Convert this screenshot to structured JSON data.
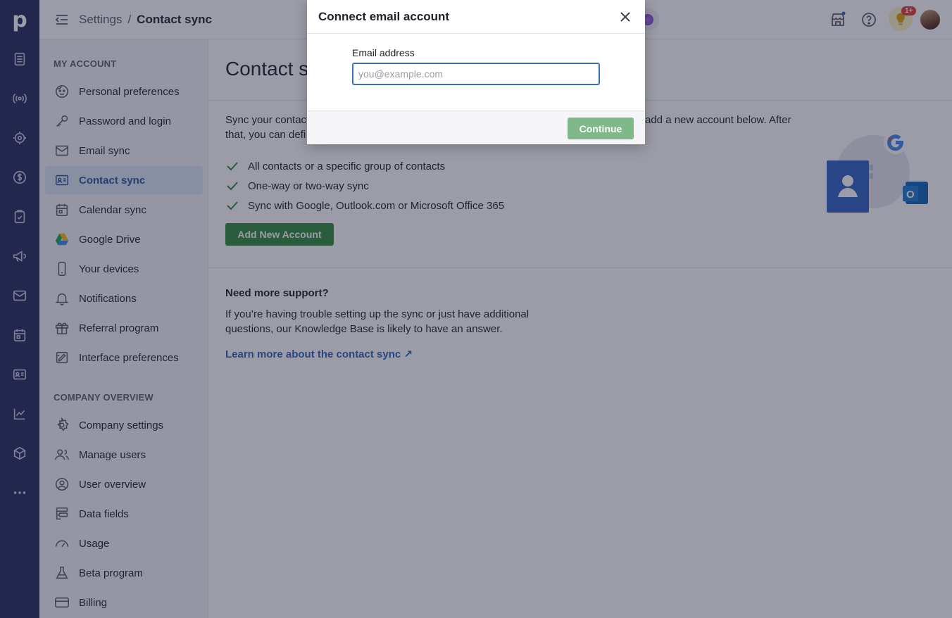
{
  "app": {
    "logo": "p"
  },
  "breadcrumb": {
    "parent": "Settings",
    "separator": "/",
    "current": "Contact sync"
  },
  "topbar": {
    "notification_badge": "1+"
  },
  "sidebar": {
    "section_account": "MY ACCOUNT",
    "account_items": [
      {
        "label": "Personal preferences",
        "icon": "face-icon"
      },
      {
        "label": "Password and login",
        "icon": "key-icon"
      },
      {
        "label": "Email sync",
        "icon": "mail-icon"
      },
      {
        "label": "Contact sync",
        "icon": "contact-card-icon",
        "active": true
      },
      {
        "label": "Calendar sync",
        "icon": "calendar-icon"
      },
      {
        "label": "Google Drive",
        "icon": "google-drive-icon"
      },
      {
        "label": "Your devices",
        "icon": "phone-icon"
      },
      {
        "label": "Notifications",
        "icon": "bell-icon"
      },
      {
        "label": "Referral program",
        "icon": "gift-icon"
      },
      {
        "label": "Interface preferences",
        "icon": "interface-icon"
      }
    ],
    "section_company": "COMPANY OVERVIEW",
    "company_items": [
      {
        "label": "Company settings",
        "icon": "gear-icon"
      },
      {
        "label": "Manage users",
        "icon": "users-icon"
      },
      {
        "label": "User overview",
        "icon": "user-circle-icon"
      },
      {
        "label": "Data fields",
        "icon": "data-fields-icon"
      },
      {
        "label": "Usage",
        "icon": "gauge-icon"
      },
      {
        "label": "Beta program",
        "icon": "flask-icon"
      },
      {
        "label": "Billing",
        "icon": "credit-card-icon"
      }
    ]
  },
  "main": {
    "title": "Contact sync",
    "intro_line1": "Sync your contacts",
    "intro_line1_end": "add a new account below. After",
    "intro_line2": "that, you can defi",
    "checks": [
      "All contacts or a specific group of contacts",
      "One-way or two-way sync",
      "Sync with Google, Outlook.com or Microsoft Office 365"
    ],
    "add_button": "Add New Account",
    "support_heading": "Need more support?",
    "support_text": "If you’re having trouble setting up the sync or just have additional questions, our Knowledge Base is likely to have an answer.",
    "support_link": "Learn more about the contact sync ↗"
  },
  "dialog": {
    "title": "Connect email account",
    "email_label": "Email address",
    "email_placeholder": "you@example.com",
    "email_value": "",
    "continue_button": "Continue"
  },
  "colors": {
    "rail": "#26295b",
    "accent_green": "#2e8a3e",
    "link_blue": "#2e63b7",
    "active_item_bg": "#dce7f7"
  }
}
